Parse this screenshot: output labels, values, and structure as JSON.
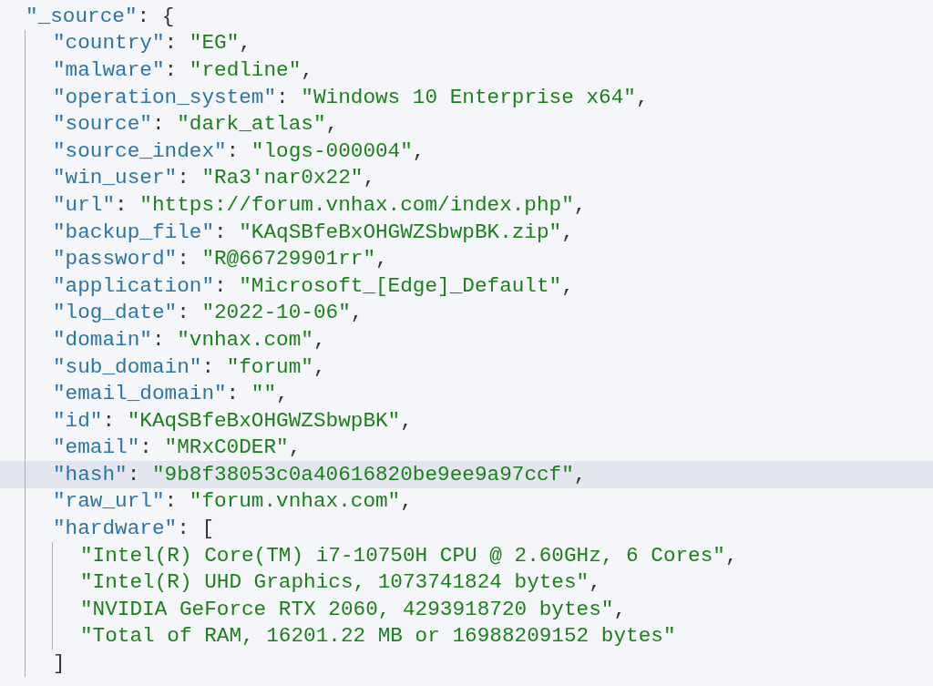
{
  "editor": {
    "root": {
      "key": "\"_source\"",
      "colon": ":",
      "bracket": "{",
      "current": false,
      "children": [
        {
          "key": "\"country\"",
          "colon": ":",
          "value": "\"EG\"",
          "after": ",",
          "current": false
        },
        {
          "key": "\"malware\"",
          "colon": ":",
          "value": "\"redline\"",
          "after": ",",
          "current": false
        },
        {
          "key": "\"operation_system\"",
          "colon": ":",
          "value": "\"Windows 10 Enterprise x64\"",
          "after": ",",
          "current": false
        },
        {
          "key": "\"source\"",
          "colon": ":",
          "value": "\"dark_atlas\"",
          "after": ",",
          "current": false
        },
        {
          "key": "\"source_index\"",
          "colon": ":",
          "value": "\"logs-000004\"",
          "after": ",",
          "current": false
        },
        {
          "key": "\"win_user\"",
          "colon": ":",
          "value": "\"Ra3'nar0x22\"",
          "after": ",",
          "current": false
        },
        {
          "key": "\"url\"",
          "colon": ":",
          "value": "\"https://forum.vnhax.com/index.php\"",
          "after": ",",
          "current": false
        },
        {
          "key": "\"backup_file\"",
          "colon": ":",
          "value": "\"KAqSBfeBxOHGWZSbwpBK.zip\"",
          "after": ",",
          "current": false
        },
        {
          "key": "\"password\"",
          "colon": ":",
          "value": "\"R@66729901rr\"",
          "after": ",",
          "current": false
        },
        {
          "key": "\"application\"",
          "colon": ":",
          "value": "\"Microsoft_[Edge]_Default\"",
          "after": ",",
          "current": false
        },
        {
          "key": "\"log_date\"",
          "colon": ":",
          "value": "\"2022-10-06\"",
          "after": ",",
          "current": false
        },
        {
          "key": "\"domain\"",
          "colon": ":",
          "value": "\"vnhax.com\"",
          "after": ",",
          "current": false
        },
        {
          "key": "\"sub_domain\"",
          "colon": ":",
          "value": "\"forum\"",
          "after": ",",
          "current": false
        },
        {
          "key": "\"email_domain\"",
          "colon": ":",
          "value": "\"\"",
          "after": ",",
          "current": false
        },
        {
          "key": "\"id\"",
          "colon": ":",
          "value": "\"KAqSBfeBxOHGWZSbwpBK\"",
          "after": ",",
          "current": false
        },
        {
          "key": "\"email\"",
          "colon": ":",
          "value": "\"MRxC0DER\"",
          "after": ",",
          "current": false
        },
        {
          "key": "\"hash\"",
          "colon": ":",
          "value": "\"9b8f38053c0a40616820be9ee9a97ccf\"",
          "after": ",",
          "current": true
        },
        {
          "key": "\"raw_url\"",
          "colon": ":",
          "value": "\"forum.vnhax.com\"",
          "after": ",",
          "current": false
        },
        {
          "key": "\"hardware\"",
          "colon": ":",
          "bracket": "[",
          "current": false,
          "close": "]",
          "children": [
            {
              "value": "\"Intel(R) Core(TM) i7-10750H CPU @ 2.60GHz, 6 Cores\"",
              "after": ",",
              "current": false
            },
            {
              "value": "\"Intel(R) UHD Graphics, 1073741824 bytes\"",
              "after": ",",
              "current": false
            },
            {
              "value": "\"NVIDIA GeForce RTX 2060, 4293918720 bytes\"",
              "after": ",",
              "current": false
            },
            {
              "value": "\"Total of RAM, 16201.22 MB or 16988209152 bytes\"",
              "current": false
            }
          ]
        }
      ]
    }
  }
}
